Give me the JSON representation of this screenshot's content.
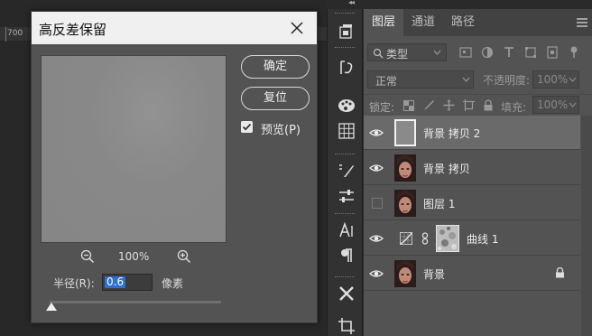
{
  "ruler": {
    "label": "700"
  },
  "dialog": {
    "title": "高反差保留",
    "ok_label": "确定",
    "reset_label": "复位",
    "preview_label": "预览(P)",
    "preview_checked": true,
    "zoom_value": "100%",
    "radius_label": "半径(R):",
    "radius_value": "0.6",
    "radius_unit": "像素"
  },
  "tools": [
    "history-brush-icon",
    "3d-rotate-icon",
    "palette-icon",
    "grid-icon",
    "brush-settings-icon",
    "sliders-icon",
    "character-icon",
    "paragraph-icon",
    "tools-icon",
    "crop-icon"
  ],
  "panel": {
    "tabs": [
      {
        "label": "图层",
        "active": true
      },
      {
        "label": "通道",
        "active": false
      },
      {
        "label": "路径",
        "active": false
      }
    ],
    "filter": {
      "placeholder": "类型"
    },
    "blend_mode": "正常",
    "opacity_label": "不透明度:",
    "opacity_value": "100%",
    "lock_label": "锁定:",
    "fill_label": "填充:",
    "fill_value": "100%",
    "layers": [
      {
        "name": "背景 拷贝 2",
        "visible": true,
        "selected": true,
        "thumb": "gray",
        "locked": false
      },
      {
        "name": "背景 拷贝",
        "visible": true,
        "selected": false,
        "thumb": "portrait",
        "locked": false
      },
      {
        "name": "图层 1",
        "visible": false,
        "selected": false,
        "thumb": "portrait",
        "locked": false
      },
      {
        "name": "曲线 1",
        "visible": true,
        "selected": false,
        "thumb": "adjustment",
        "locked": false
      },
      {
        "name": "背景",
        "visible": true,
        "selected": false,
        "thumb": "portrait",
        "locked": true
      }
    ]
  },
  "colors": {
    "dialog_bg": "#535353",
    "panel_bg": "#535353",
    "selected_layer": "#6a6a6a",
    "selection_blue": "#2f6fcf"
  }
}
